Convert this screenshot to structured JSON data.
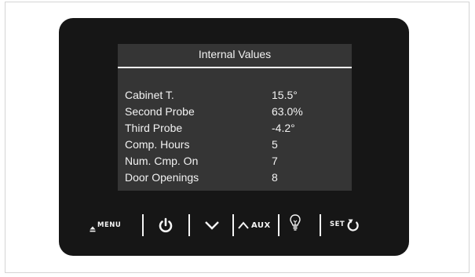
{
  "screen": {
    "title": "Internal Values",
    "rows": [
      {
        "label": "Cabinet T.",
        "value": "15.5°"
      },
      {
        "label": "Second Probe",
        "value": "63.0%"
      },
      {
        "label": "Third Probe",
        "value": "-4.2°"
      },
      {
        "label": "Comp. Hours",
        "value": "5"
      },
      {
        "label": "Num. Cmp. On",
        "value": "7"
      },
      {
        "label": "Door Openings",
        "value": "8"
      }
    ]
  },
  "buttons": {
    "menu_label": "MENU",
    "aux_label": "AUX",
    "set_label": "SET"
  },
  "icons": {
    "menu": "eject-icon",
    "power": "power-icon",
    "down": "chevron-down-icon",
    "up": "chevron-up-icon",
    "light": "light-bulb-icon",
    "set": "refresh-icon"
  },
  "colors": {
    "device_body": "#161616",
    "screen_background": "#353535",
    "text": "#f2f2f2"
  }
}
